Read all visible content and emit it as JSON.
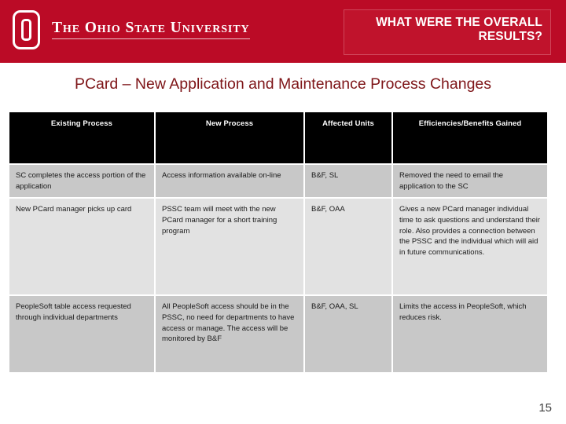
{
  "header": {
    "band_color": "#bb0b26",
    "logo": {
      "icon": "block-o-logo",
      "wordmark": "The Ohio State University"
    },
    "title_box": {
      "line_1": "WHAT WERE THE OVERALL",
      "line_2": "RESULTS?",
      "background_color": "#c0132c",
      "border_color": "#cf465a"
    }
  },
  "subtitle": {
    "text": "PCard – New Application and Maintenance Process Changes",
    "color": "#7e1518"
  },
  "table": {
    "header_background": "#000000",
    "header_text_color": "#ffffff",
    "row_shade_a": "#c8c8c8",
    "row_shade_b": "#e2e2e2",
    "columns": [
      "Existing Process",
      "New Process",
      "Affected Units",
      "Efficiencies/Benefits Gained"
    ],
    "rows": [
      {
        "existing_process": "SC completes the access portion of the application",
        "new_process": "Access information available on-line",
        "affected_units": "B&F, SL",
        "efficiencies": "Removed the need to email the application to the SC"
      },
      {
        "existing_process": "New PCard manager picks up card",
        "new_process": "PSSC team will meet with the new PCard manager for a short training program",
        "affected_units": "B&F, OAA",
        "efficiencies": "Gives a new PCard manager individual time to ask questions and understand their role. Also provides a connection between the PSSC and the individual which will aid in future communications."
      },
      {
        "existing_process": "PeopleSoft table access requested through individual departments",
        "new_process": "All PeopleSoft access should be in the PSSC, no need for departments to have access or manage. The access will be monitored by B&F",
        "affected_units": "B&F, OAA, SL",
        "efficiencies": "Limits the access in PeopleSoft, which reduces risk."
      }
    ]
  },
  "footer": {
    "page_number": "15"
  }
}
